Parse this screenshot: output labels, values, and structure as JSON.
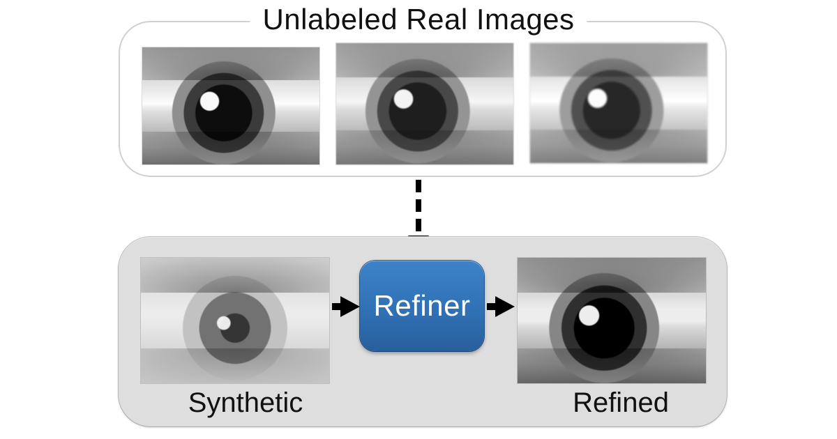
{
  "title_top": "Unlabeled Real Images",
  "refiner_label": "Refiner",
  "captions": {
    "synthetic": "Synthetic",
    "refined": "Refined"
  },
  "colors": {
    "refiner_bg": "#2f6fb3",
    "panel_bottom_bg": "#dedede",
    "panel_top_border": "#d0d0d0"
  },
  "images": {
    "real": [
      {
        "name": "real-eye-1",
        "style": "grayscale eye crop, sharp contrast"
      },
      {
        "name": "real-eye-2",
        "style": "grayscale eye crop, slightly soft"
      },
      {
        "name": "real-eye-3",
        "style": "grayscale eye crop, blurry / defocused"
      }
    ],
    "synthetic": {
      "name": "synthetic-eye",
      "style": "rendered / CG-looking grayscale eye"
    },
    "refined": {
      "name": "refined-eye",
      "style": "photo-real grayscale eye, output of refiner"
    }
  },
  "flow": [
    {
      "from": "unlabeled_real_images_panel",
      "to": "refiner_block",
      "style": "dashed-down"
    },
    {
      "from": "synthetic_image",
      "to": "refiner_block",
      "style": "solid-right"
    },
    {
      "from": "refiner_block",
      "to": "refined_image",
      "style": "solid-right"
    }
  ]
}
